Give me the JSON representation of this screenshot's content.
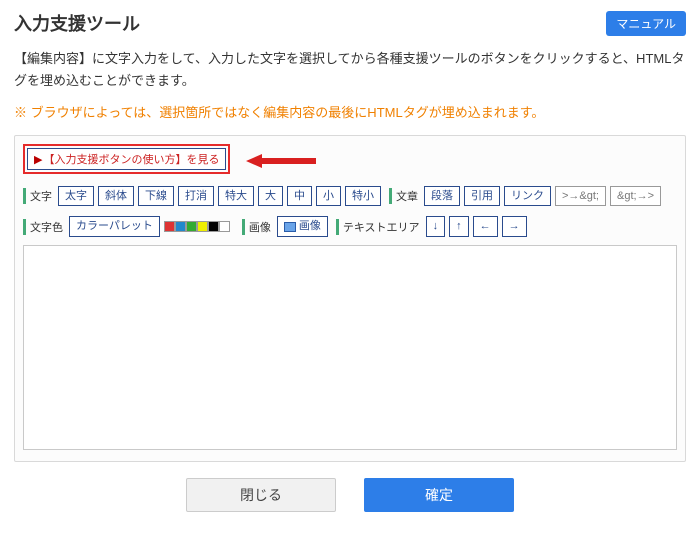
{
  "header": {
    "title": "入力支援ツール",
    "manual": "マニュアル"
  },
  "desc": "【編集内容】に文字入力をして、入力した文字を選択してから各種支援ツールのボタンをクリックすると、HTMLタグを埋め込むことができます。",
  "warn": "※ ブラウザによっては、選択箇所ではなく編集内容の最後にHTMLタグが埋め込まれます。",
  "help_link": "【入力支援ボタンの使い方】を見る",
  "toolbar": {
    "groups": {
      "text": {
        "label": "文字",
        "buttons": [
          "太字",
          "斜体",
          "下線",
          "打消",
          "特大",
          "大",
          "中",
          "小",
          "特小"
        ]
      },
      "article": {
        "label": "文章",
        "buttons": [
          "段落",
          "引用",
          "リンク",
          ">→&gt;",
          "&gt;→>"
        ]
      },
      "color": {
        "label": "文字色",
        "palette_button": "カラーパレット",
        "swatches": [
          "#d33",
          "#28c",
          "#3a3",
          "#ee0",
          "#000",
          "#fff"
        ]
      },
      "image": {
        "label": "画像",
        "button": "画像"
      },
      "textarea": {
        "label": "テキストエリア",
        "buttons": [
          "↓",
          "↑",
          "←",
          "→"
        ]
      }
    }
  },
  "editor": {
    "value": ""
  },
  "footer": {
    "close": "閉じる",
    "confirm": "確定"
  }
}
